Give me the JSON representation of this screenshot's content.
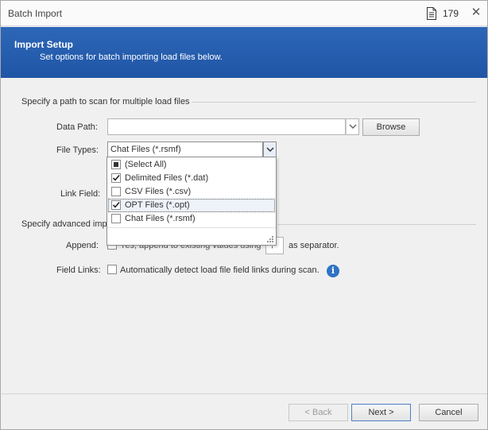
{
  "window": {
    "title": "Batch Import",
    "count": "179",
    "close_symbol": "✕"
  },
  "header": {
    "title": "Import Setup",
    "subtitle": "Set options for batch importing load files below."
  },
  "scan_section": {
    "heading": "Specify a path to scan for multiple load files",
    "data_path_label": "Data Path:",
    "data_path_value": "",
    "browse_label": "Browse",
    "file_types_label": "File Types:",
    "file_types_value": "Chat Files (*.rsmf)",
    "link_field_label": "Link Field:"
  },
  "file_types_options": [
    {
      "label": "(Select All)",
      "state": "mixed"
    },
    {
      "label": "Delimited Files (*.dat)",
      "state": "checked"
    },
    {
      "label": "CSV Files (*.csv)",
      "state": "unchecked"
    },
    {
      "label": "OPT Files (*.opt)",
      "state": "checked"
    },
    {
      "label": "Chat Files (*.rsmf)",
      "state": "unchecked"
    }
  ],
  "advanced_section": {
    "heading_visible": "Specify advanced impo",
    "append_label": "Append:",
    "append_text_visible": "Yes, append to existing values using",
    "separator_value": ";",
    "separator_suffix": "as separator.",
    "field_links_label": "Field Links:",
    "field_links_text": "Automatically detect load file field links during scan.",
    "info_symbol": "i"
  },
  "footer": {
    "back_label": "< Back",
    "next_label": "Next >",
    "cancel_label": "Cancel"
  },
  "colors": {
    "header_blue": "#2460b0",
    "info_blue": "#2e73c3"
  }
}
